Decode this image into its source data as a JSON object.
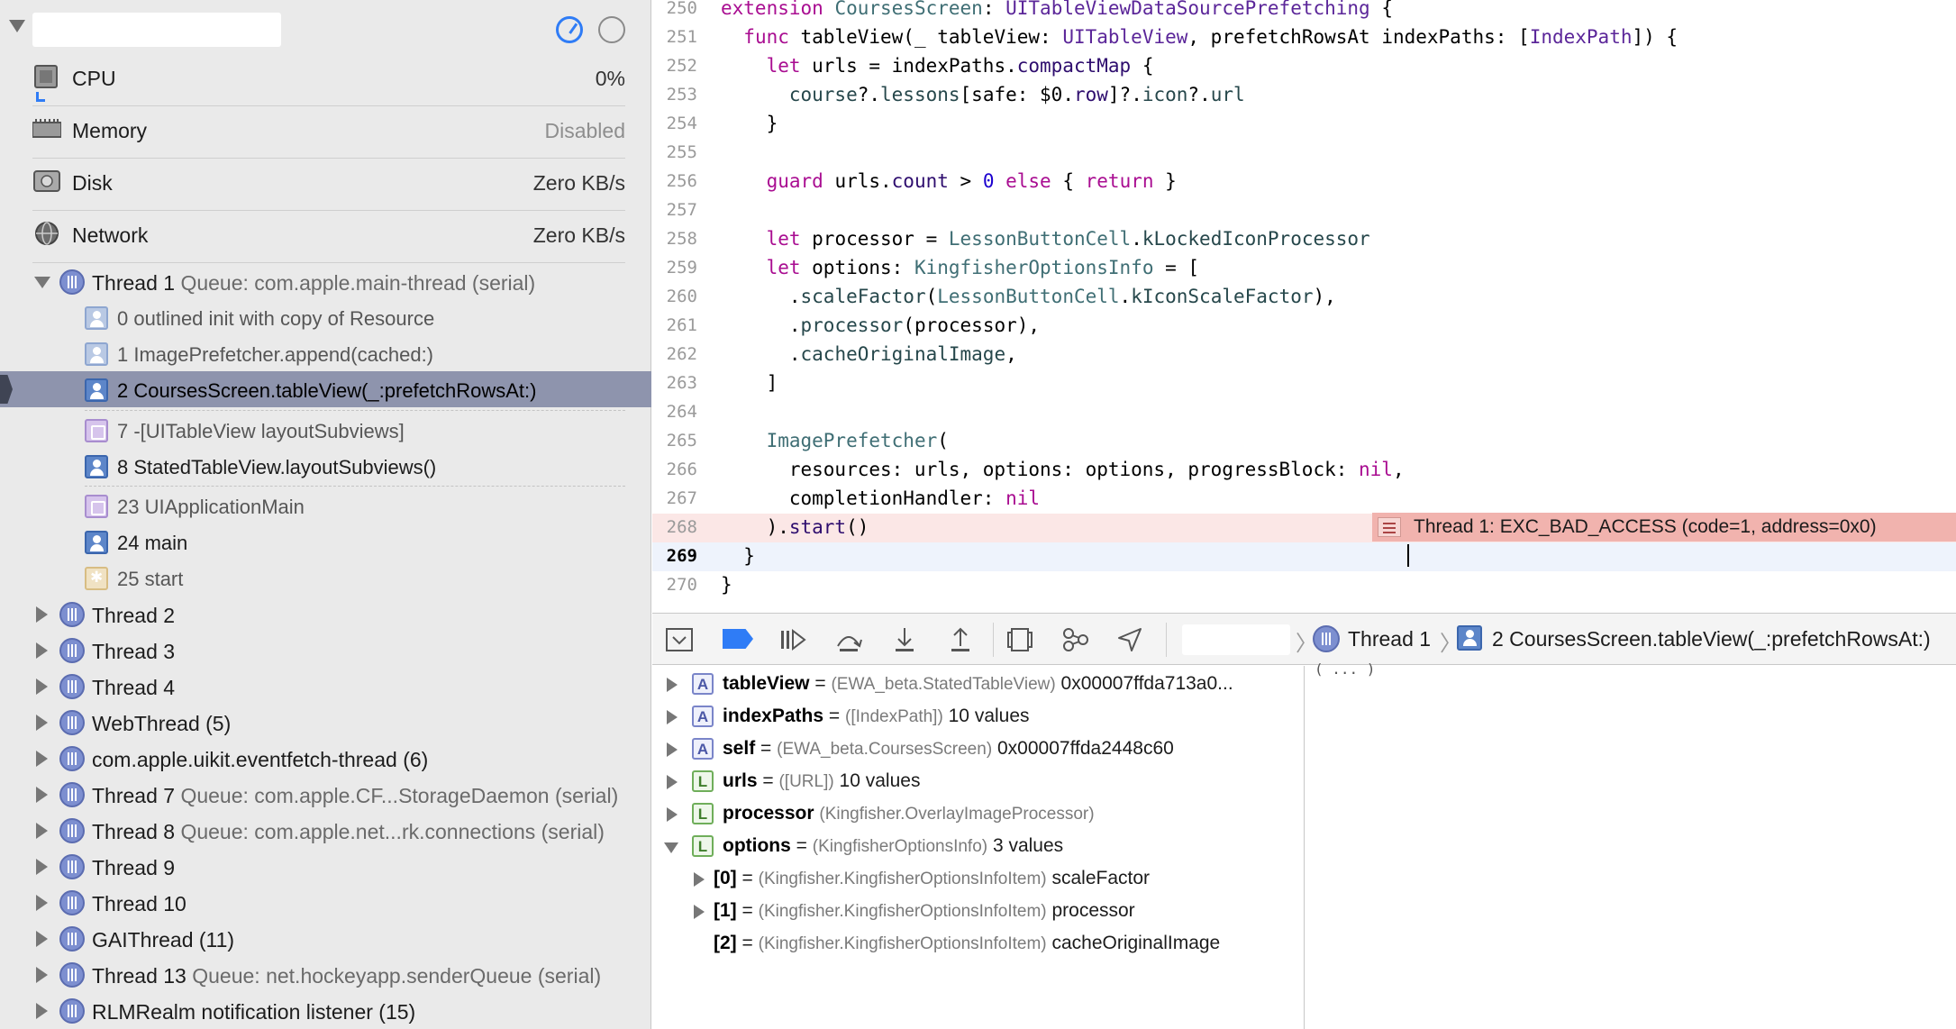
{
  "navigator": {
    "gauges": [
      {
        "name": "CPU",
        "value": "0%"
      },
      {
        "name": "Memory",
        "value": "Disabled"
      },
      {
        "name": "Disk",
        "value": "Zero KB/s"
      },
      {
        "name": "Network",
        "value": "Zero KB/s"
      }
    ],
    "threads": [
      {
        "name": "Thread 1",
        "queue": "Queue: com.apple.main-thread (serial)",
        "expanded": true
      },
      {
        "name": "Thread 2",
        "queue": ""
      },
      {
        "name": "Thread 3",
        "queue": ""
      },
      {
        "name": "Thread 4",
        "queue": ""
      },
      {
        "name": "WebThread (5)",
        "queue": ""
      },
      {
        "name": "com.apple.uikit.eventfetch-thread (6)",
        "queue": ""
      },
      {
        "name": "Thread 7",
        "queue": "Queue: com.apple.CF...StorageDaemon (serial)"
      },
      {
        "name": "Thread 8",
        "queue": "Queue: com.apple.net...rk.connections (serial)"
      },
      {
        "name": "Thread 9",
        "queue": ""
      },
      {
        "name": "Thread 10",
        "queue": ""
      },
      {
        "name": "GAIThread (11)",
        "queue": ""
      },
      {
        "name": "Thread 13",
        "queue": "Queue: net.hockeyapp.senderQueue (serial)"
      },
      {
        "name": "RLMRealm notification listener (15)",
        "queue": ""
      }
    ],
    "frames": [
      {
        "label": "0 outlined init with copy of Resource",
        "icon": "user-frame-icon",
        "dim": true
      },
      {
        "label": "1 ImagePrefetcher.append(cached:)",
        "icon": "user-frame-icon",
        "dim": true
      },
      {
        "label": "2 CoursesScreen.tableView(_:prefetchRowsAt:)",
        "icon": "user-frame-icon",
        "selected": true
      },
      {
        "label": "7 -[UITableView layoutSubviews]",
        "icon": "system-frame-icon",
        "dim": true
      },
      {
        "label": "8 StatedTableView.layoutSubviews()",
        "icon": "user-frame-icon"
      },
      {
        "label": "23 UIApplicationMain",
        "icon": "system-frame-icon",
        "dim": true
      },
      {
        "label": "24 main",
        "icon": "user-frame-icon"
      },
      {
        "label": "25 start",
        "icon": "start-frame-icon",
        "dim": true
      }
    ]
  },
  "editor": {
    "lines": [
      {
        "n": "250",
        "text": "extension CoursesScreen: UITableViewDataSourcePrefetching {"
      },
      {
        "n": "251",
        "text": "  func tableView(_ tableView: UITableView, prefetchRowsAt indexPaths: [IndexPath]) {"
      },
      {
        "n": "252",
        "text": "    let urls = indexPaths.compactMap {"
      },
      {
        "n": "253",
        "text": "      course?.lessons[safe: $0.row]?.icon?.url"
      },
      {
        "n": "254",
        "text": "    }"
      },
      {
        "n": "255",
        "text": ""
      },
      {
        "n": "256",
        "text": "    guard urls.count > 0 else { return }"
      },
      {
        "n": "257",
        "text": ""
      },
      {
        "n": "258",
        "text": "    let processor = LessonButtonCell.kLockedIconProcessor"
      },
      {
        "n": "259",
        "text": "    let options: KingfisherOptionsInfo = ["
      },
      {
        "n": "260",
        "text": "      .scaleFactor(LessonButtonCell.kIconScaleFactor),"
      },
      {
        "n": "261",
        "text": "      .processor(processor),"
      },
      {
        "n": "262",
        "text": "      .cacheOriginalImage,"
      },
      {
        "n": "263",
        "text": "    ]"
      },
      {
        "n": "264",
        "text": ""
      },
      {
        "n": "265",
        "text": "    ImagePrefetcher("
      },
      {
        "n": "266",
        "text": "      resources: urls, options: options, progressBlock: nil,"
      },
      {
        "n": "267",
        "text": "      completionHandler: nil"
      },
      {
        "n": "268",
        "text": "    ).start()"
      },
      {
        "n": "269",
        "text": "  }"
      },
      {
        "n": "270",
        "text": "}"
      }
    ],
    "error_message": "Thread 1: EXC_BAD_ACCESS (code=1, address=0x0)"
  },
  "debugbar": {
    "crumb_thread": "Thread 1",
    "crumb_frame": "2 CoursesScreen.tableView(_:prefetchRowsAt:)"
  },
  "variables": [
    {
      "kind": "A",
      "name": "tableView",
      "eq": "=",
      "type": "(EWA_beta.StatedTableView)",
      "value": "0x00007ffda713a0..."
    },
    {
      "kind": "A",
      "name": "indexPaths",
      "eq": "=",
      "type": "([IndexPath])",
      "value": "10 values"
    },
    {
      "kind": "A",
      "name": "self",
      "eq": "=",
      "type": "(EWA_beta.CoursesScreen)",
      "value": "0x00007ffda2448c60"
    },
    {
      "kind": "L",
      "name": "urls",
      "eq": "=",
      "type": "([URL])",
      "value": "10 values"
    },
    {
      "kind": "L",
      "name": "processor",
      "eq": "",
      "type": "(Kingfisher.OverlayImageProcessor)",
      "value": ""
    },
    {
      "kind": "L",
      "name": "options",
      "eq": "=",
      "type": "(KingfisherOptionsInfo)",
      "value": "3 values"
    },
    {
      "kind": "",
      "name": "[0]",
      "eq": "=",
      "type": "(Kingfisher.KingfisherOptionsInfoItem)",
      "value": "scaleFactor"
    },
    {
      "kind": "",
      "name": "[1]",
      "eq": "=",
      "type": "(Kingfisher.KingfisherOptionsInfoItem)",
      "value": "processor"
    },
    {
      "kind": "",
      "name": "[2]",
      "eq": "=",
      "type": "(Kingfisher.KingfisherOptionsInfoItem)",
      "value": "cacheOriginalImage"
    }
  ],
  "console": {
    "fragment": "                 ( ... )"
  }
}
